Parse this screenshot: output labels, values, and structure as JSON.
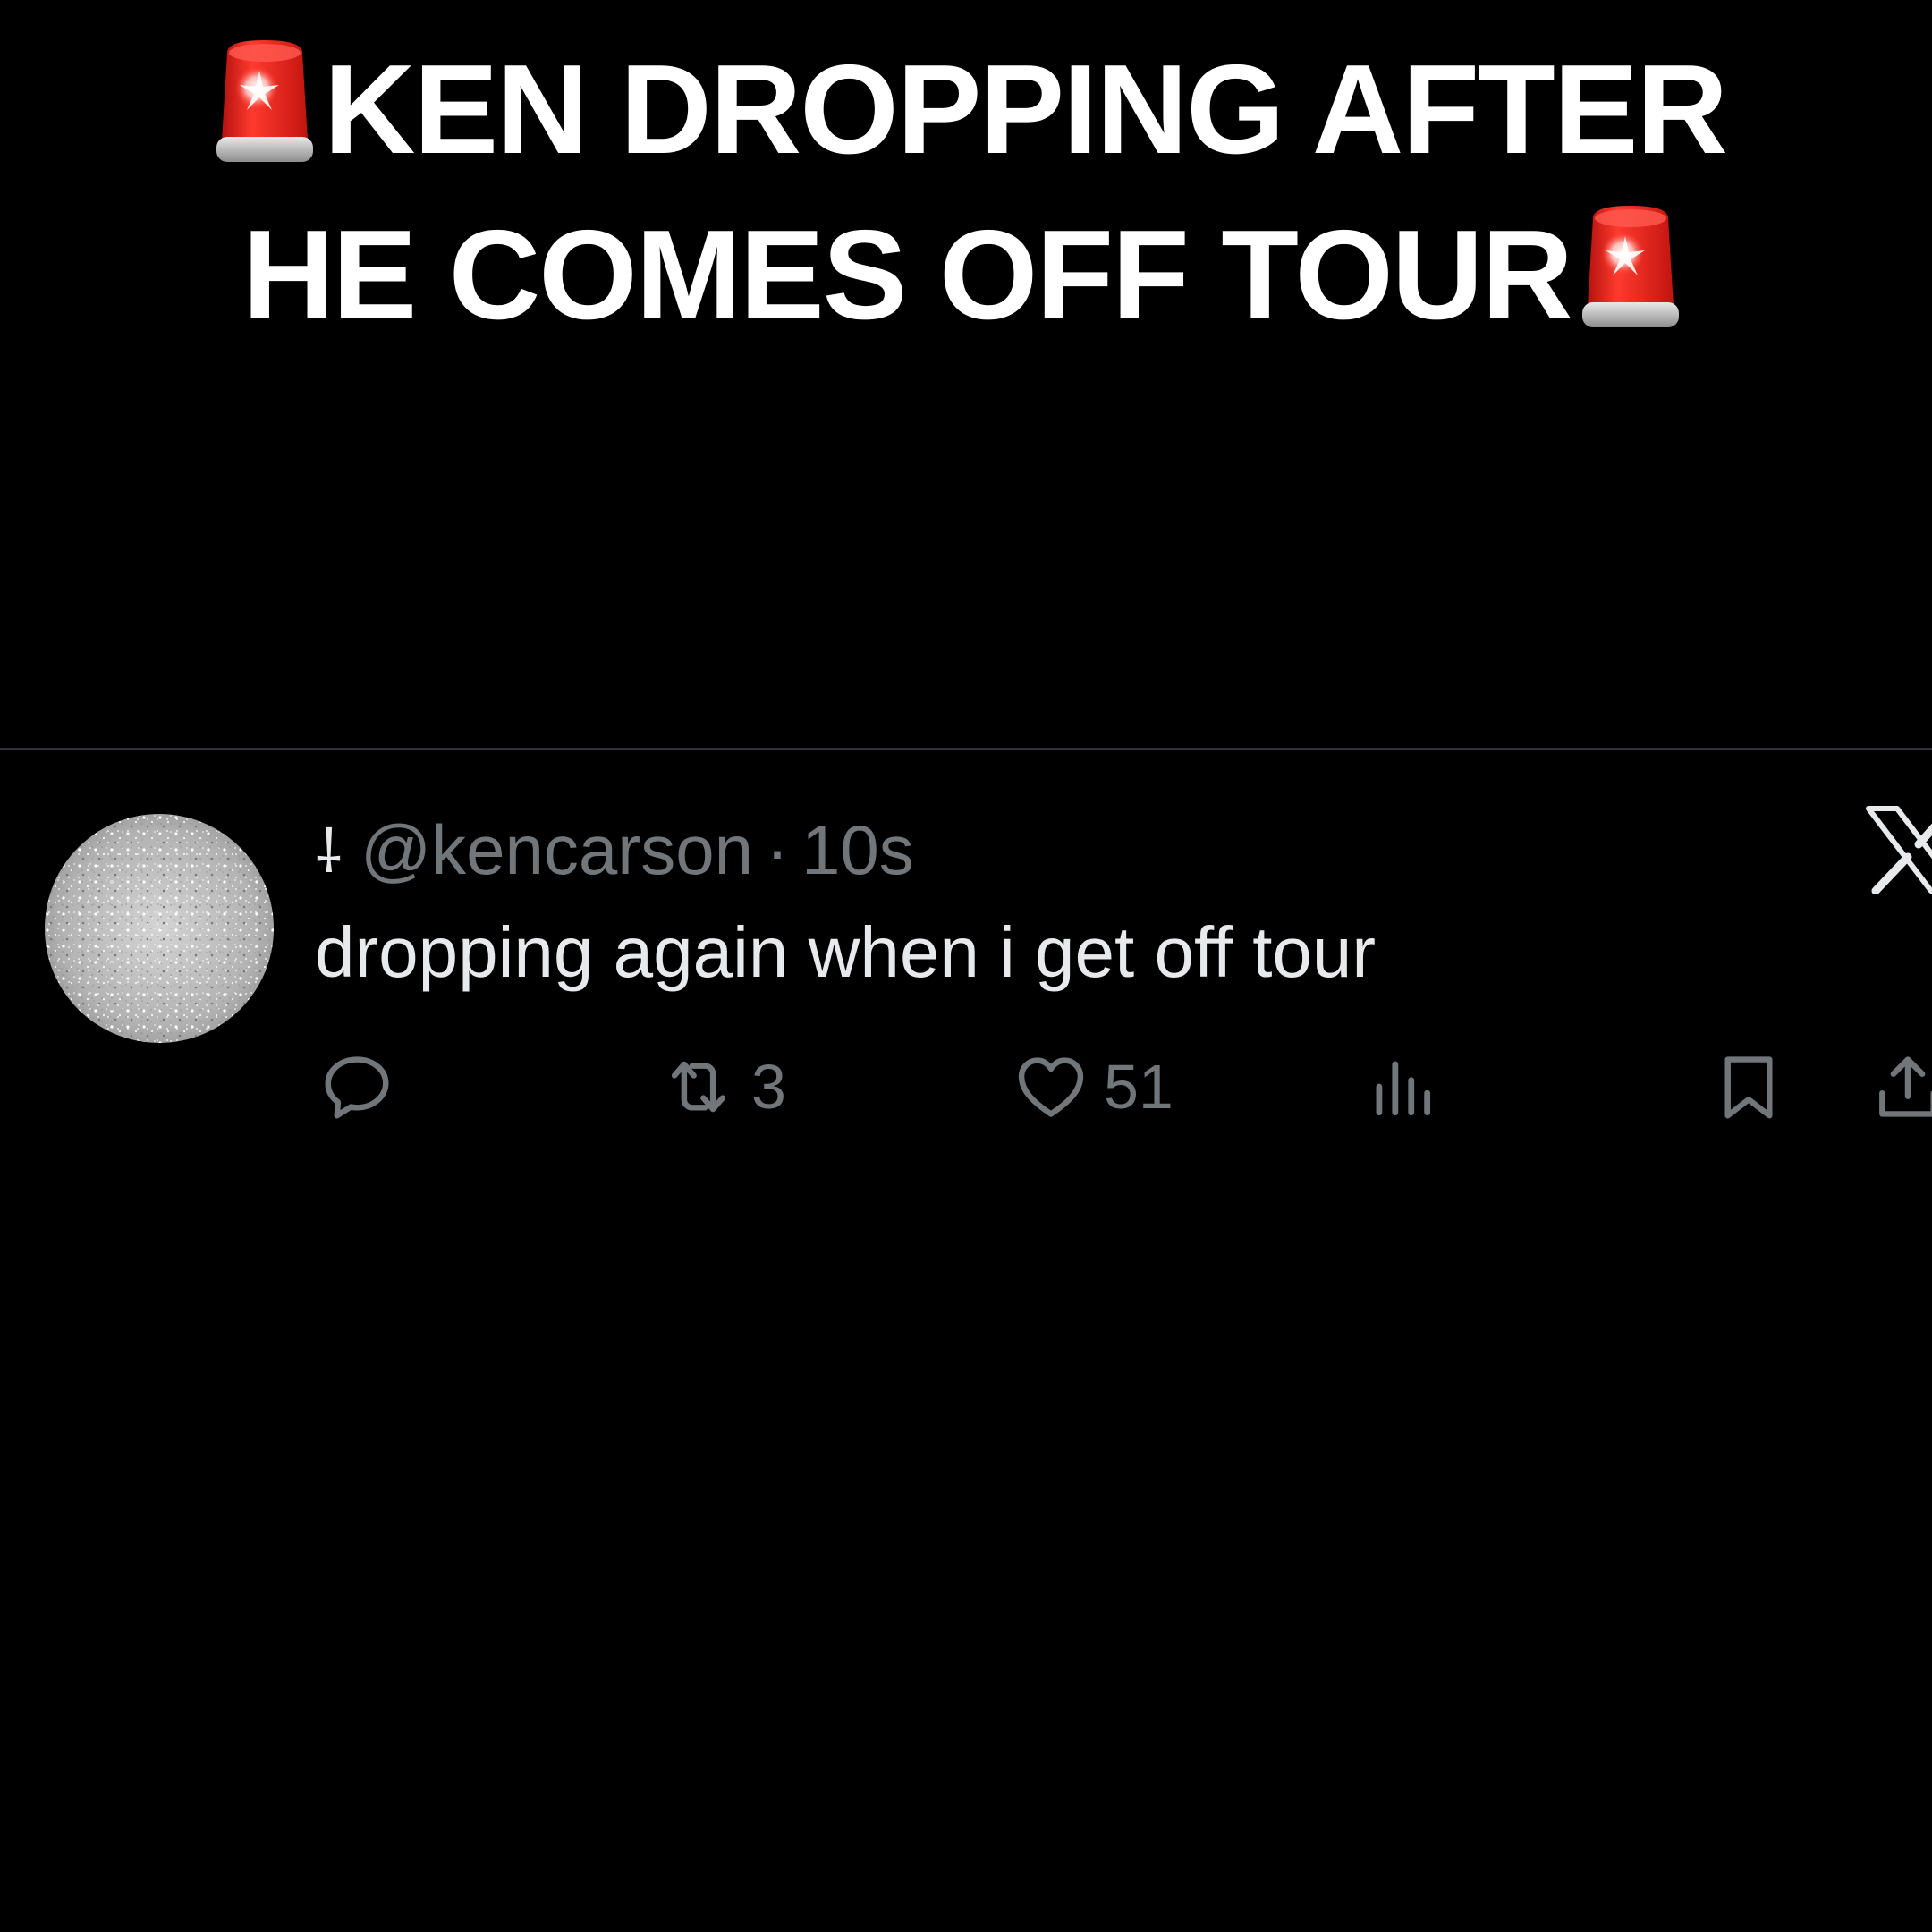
{
  "headline": {
    "line1": "KEN DROPPING AFTER",
    "line2": "HE COMES OFF TOUR",
    "emoji": "police-car-light"
  },
  "tweet": {
    "prefix_glyph": "⸸",
    "handle": "@kencarson",
    "separator": "·",
    "time": "10s",
    "text": "dropping again when i get off tour",
    "platform_logo": "x-logo",
    "actions": {
      "reply": {
        "icon": "reply-icon",
        "count": ""
      },
      "repost": {
        "icon": "repost-icon",
        "count": "3"
      },
      "like": {
        "icon": "heart-icon",
        "count": "51"
      },
      "views": {
        "icon": "views-icon",
        "count": ""
      },
      "bookmark": {
        "icon": "bookmark-icon"
      },
      "share": {
        "icon": "share-icon"
      }
    }
  },
  "colors": {
    "background": "#000000",
    "primary_text": "#e7e9ea",
    "secondary_text": "#71767b",
    "divider": "#2f3336",
    "siren_red": "#e52620"
  }
}
